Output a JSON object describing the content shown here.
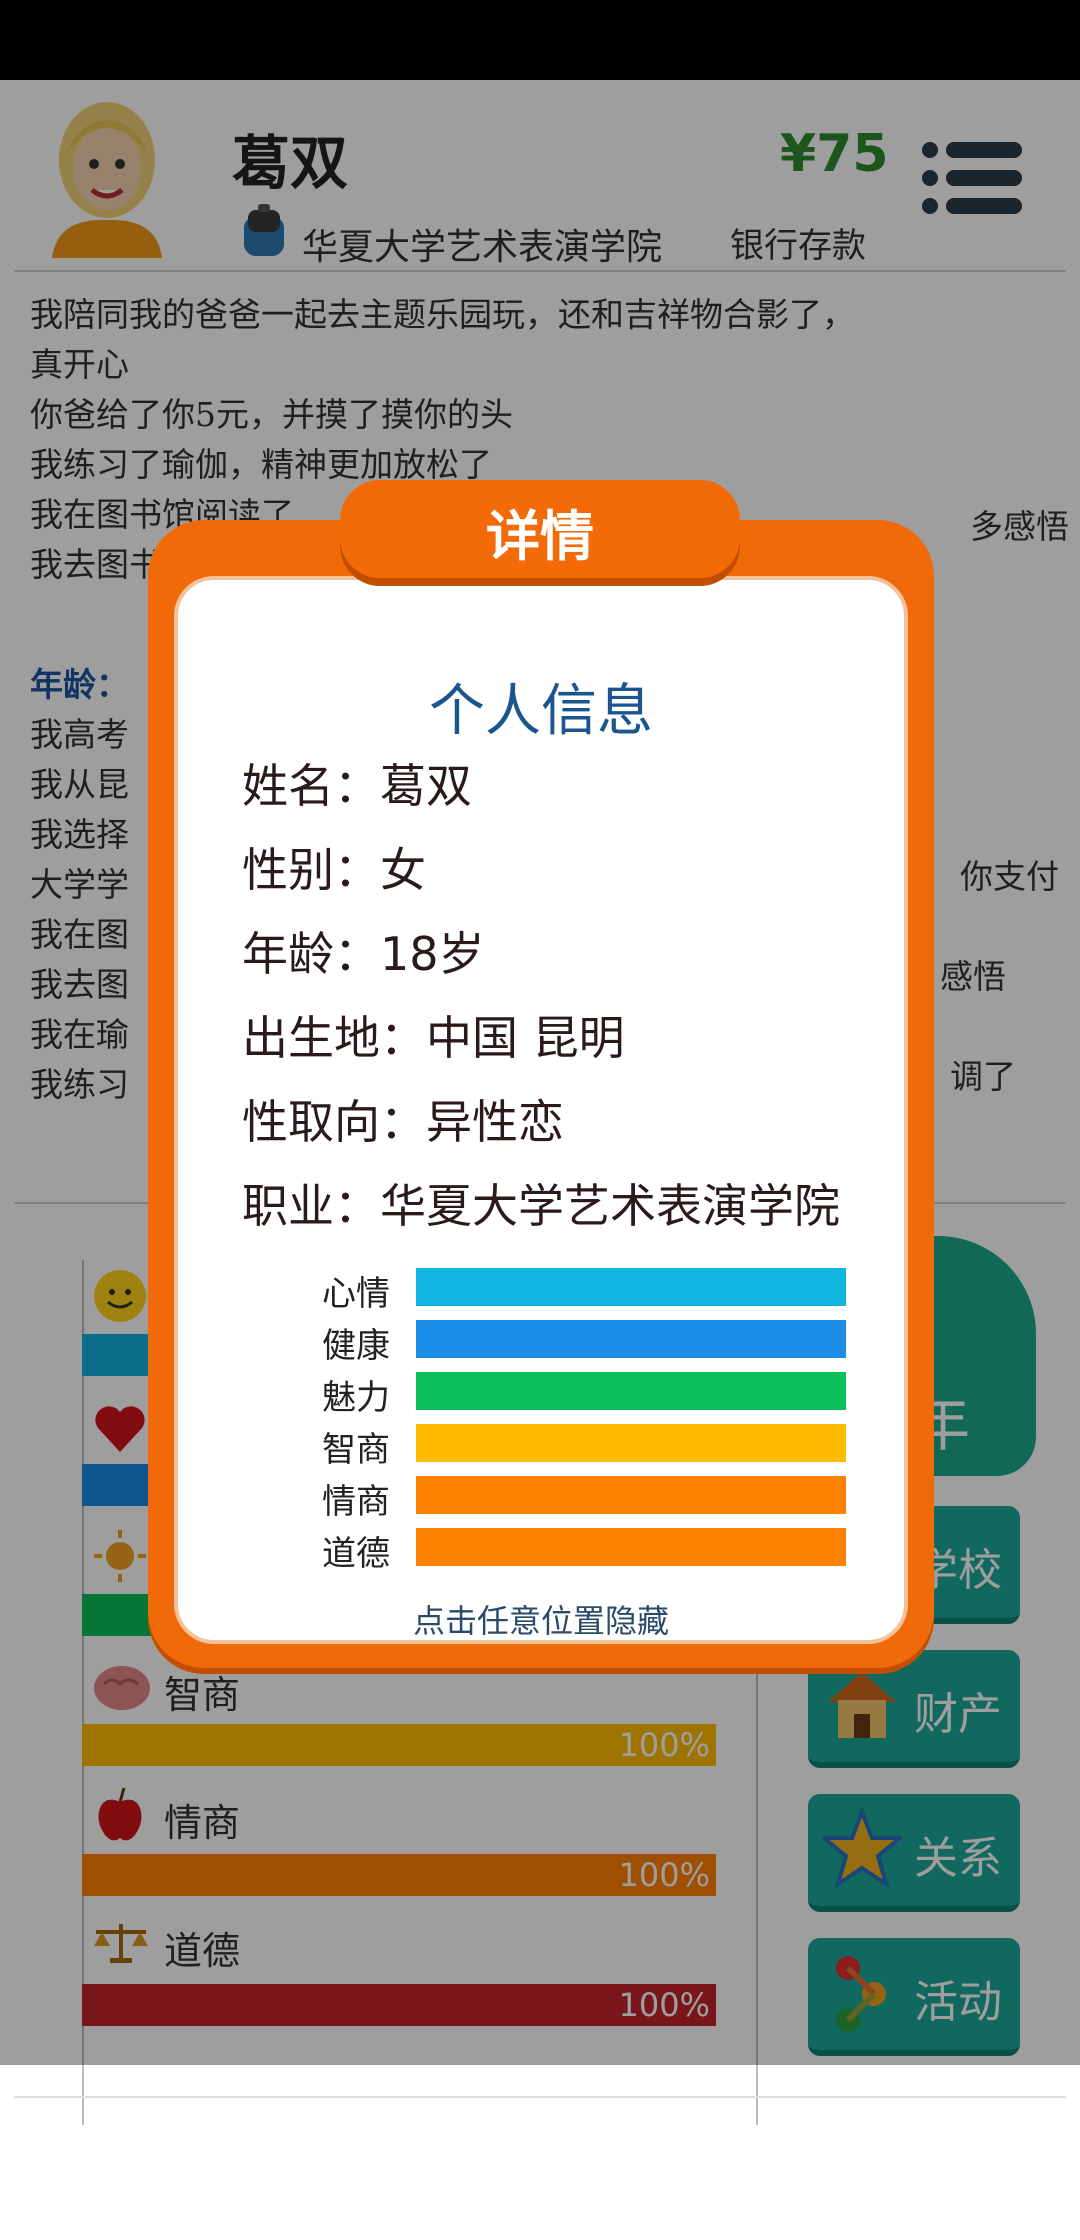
{
  "header": {
    "name": "葛双",
    "school": "华夏大学艺术表演学院",
    "money": "¥75",
    "bank_label": "银行存款"
  },
  "log": {
    "lines_top": [
      "我陪同我的爸爸一起去主题乐园玩，还和吉祥物合影了，",
      "真开心",
      "你爸给了你5元，并摸了摸你的头",
      "我练习了瑜伽，精神更加放松了",
      "我在图书馆阅读了",
      "我去图书"
    ],
    "age_label": "年龄：",
    "lines_bottom": [
      "我高考",
      "我从昆",
      "我选择",
      "大学学",
      "我在图",
      "我去图",
      "我在瑜",
      "我练习"
    ],
    "right_fragments": [
      "多感悟",
      "你支付",
      "感悟",
      "调了"
    ]
  },
  "stats": [
    {
      "label": "智商",
      "pct": "100%",
      "icon": "brain-icon",
      "color": "#c58f00"
    },
    {
      "label": "情商",
      "pct": "100%",
      "icon": "apple-icon",
      "color": "#c85a00"
    },
    {
      "label": "道德",
      "pct": "100%",
      "icon": "scales-icon",
      "color": "#9a1a20"
    }
  ],
  "side_buttons": [
    "学校",
    "财产",
    "关系",
    "活动"
  ],
  "year_button": "一年",
  "modal": {
    "tab_title": "详情",
    "heading": "个人信息",
    "fields": [
      {
        "k": "姓名：",
        "v": "葛双"
      },
      {
        "k": "性别：",
        "v": "女"
      },
      {
        "k": "年龄：",
        "v": "18岁"
      },
      {
        "k": "出生地：",
        "v": "中国 昆明"
      },
      {
        "k": "性取向：",
        "v": "异性恋"
      },
      {
        "k": "职业：",
        "v": "华夏大学艺术表演学院"
      }
    ],
    "bars": [
      {
        "label": "心情",
        "color": "#12b4e0",
        "level": 1.0
      },
      {
        "label": "健康",
        "color": "#1a8ce6",
        "level": 1.0
      },
      {
        "label": "魅力",
        "color": "#0bbf5a",
        "level": 1.0
      },
      {
        "label": "智商",
        "color": "#ffbb00",
        "level": 1.0
      },
      {
        "label": "情商",
        "color": "#ff8200",
        "level": 1.0
      },
      {
        "label": "道德",
        "color": "#ff8200",
        "level": 1.0
      }
    ],
    "hint": "点击任意位置隐藏"
  }
}
